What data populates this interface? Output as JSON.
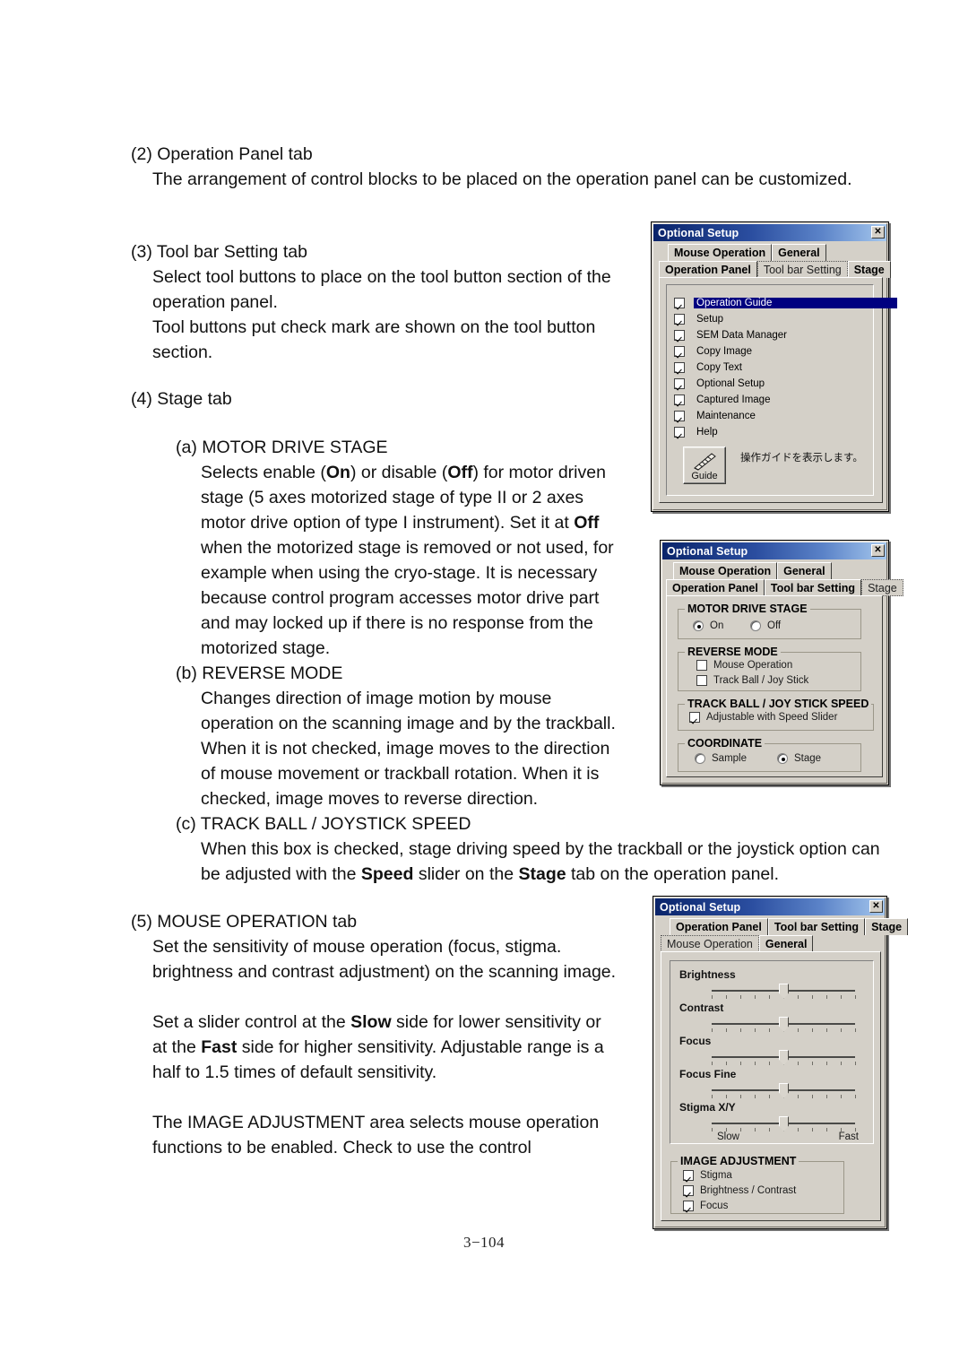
{
  "document": {
    "page_number": "3−104",
    "sections": [
      {
        "heading": "(2) Operation Panel tab",
        "body": "The arrangement of control blocks to be placed on the operation panel can be customized."
      },
      {
        "heading": "(3) Tool bar Setting tab",
        "body1": "Select tool buttons to place on the tool button section of the",
        "body2": "operation panel.",
        "body3": "Tool buttons put check mark are shown on the tool button",
        "body4": "section."
      },
      {
        "heading": "(4) Stage tab",
        "sub_a_title": "(a) MOTOR DRIVE STAGE",
        "sub_a_lines": [
          "Selects enable (On) or disable (Off) for motor driven",
          "stage (5 axes motorized stage of type II or 2 axes",
          "motor drive option of type I instrument). Set it at Off",
          "when the motorized stage is removed or not used, for",
          "example when using the cryo-stage. It is necessary",
          "because control program accesses motor drive part",
          "and may locked up if there is no response from the",
          "motorized stage."
        ],
        "sub_b_title": "(b) REVERSE MODE",
        "sub_b_lines": [
          "Changes direction of image motion by mouse",
          "operation on the scanning image and by the trackball.",
          "When it is not checked, image moves to the direction",
          "of mouse movement or trackball rotation. When it is",
          "checked, image moves to reverse direction."
        ],
        "sub_c_title": "(c) TRACK BALL / JOYSTICK SPEED",
        "sub_c_lines": [
          "When this box is checked, stage driving speed by the trackball or the joystick option can",
          "be adjusted with the Speed slider on the Stage tab on the operation panel."
        ]
      },
      {
        "heading": "(5) MOUSE OPERATION tab",
        "lines_a": [
          "Set the sensitivity of mouse operation (focus, stigma.",
          "brightness and contrast adjustment) on the scanning image."
        ],
        "lines_b": [
          "Set a slider control at the Slow side for lower sensitivity or",
          "at the Fast side for higher sensitivity. Adjustable range is a",
          "half to 1.5 times of default sensitivity."
        ],
        "lines_c": [
          "The IMAGE ADJUSTMENT area selects mouse operation",
          "functions to be enabled. Check to use the control"
        ]
      }
    ]
  },
  "colors": {
    "title_start": "#0a246a",
    "title_end": "#a6c8ee",
    "dialog_face": "#d4d0c8",
    "selection": "#000080",
    "selection_text": "#ffffff"
  },
  "dialog_toolbar": {
    "title": "Optional Setup",
    "close_label": "✕",
    "tabs_row1": [
      "Mouse Operation",
      "General"
    ],
    "tabs_row2": [
      "Operation Panel",
      "Tool bar Setting",
      "Stage"
    ],
    "selected_tab": "Tool bar Setting",
    "list_items": [
      {
        "label": "Operation Guide",
        "checked": true,
        "selected": true
      },
      {
        "label": "Setup",
        "checked": true,
        "selected": false
      },
      {
        "label": "SEM Data Manager",
        "checked": true,
        "selected": false
      },
      {
        "label": "Copy Image",
        "checked": true,
        "selected": false
      },
      {
        "label": "Copy Text",
        "checked": true,
        "selected": false
      },
      {
        "label": "Optional Setup",
        "checked": true,
        "selected": false
      },
      {
        "label": "Captured Image",
        "checked": true,
        "selected": false
      },
      {
        "label": "Maintenance",
        "checked": true,
        "selected": false
      },
      {
        "label": "Help",
        "checked": true,
        "selected": false
      }
    ],
    "guide_button_label": "Guide",
    "guide_hint": "操作ガイドを表示します。"
  },
  "dialog_stage": {
    "title": "Optional Setup",
    "close_label": "✕",
    "tabs_row1": [
      "Mouse Operation",
      "General"
    ],
    "tabs_row2": [
      "Operation Panel",
      "Tool bar Setting",
      "Stage"
    ],
    "selected_tab": "Stage",
    "motor_drive_stage": {
      "title": "MOTOR DRIVE STAGE",
      "options": [
        {
          "label": "On",
          "selected": true
        },
        {
          "label": "Off",
          "selected": false
        }
      ]
    },
    "reverse_mode": {
      "title": "REVERSE MODE",
      "options": [
        {
          "label": "Mouse Operation",
          "checked": false
        },
        {
          "label": "Track Ball / Joy Stick",
          "checked": false
        }
      ]
    },
    "track_ball_speed": {
      "title": "TRACK BALL / JOY STICK SPEED",
      "options": [
        {
          "label": "Adjustable with Speed Slider",
          "checked": true
        }
      ]
    },
    "coordinate": {
      "title": "COORDINATE",
      "options": [
        {
          "label": "Sample",
          "selected": false
        },
        {
          "label": "Stage",
          "selected": true
        }
      ]
    }
  },
  "dialog_mouse": {
    "title": "Optional Setup",
    "close_label": "✕",
    "tabs_row1": [
      "Operation Panel",
      "Tool bar Setting",
      "Stage"
    ],
    "tabs_row2": [
      "Mouse Operation",
      "General"
    ],
    "selected_tab": "Mouse Operation",
    "sliders": [
      {
        "label": "Brightness",
        "value": 50
      },
      {
        "label": "Contrast",
        "value": 50
      },
      {
        "label": "Focus",
        "value": 50
      },
      {
        "label": "Focus Fine",
        "value": 50
      },
      {
        "label": "Stigma X/Y",
        "value": 50
      }
    ],
    "scale_min_label": "Slow",
    "scale_max_label": "Fast",
    "image_adjustment": {
      "title": "IMAGE ADJUSTMENT",
      "options": [
        {
          "label": "Stigma",
          "checked": true
        },
        {
          "label": "Brightness / Contrast",
          "checked": true
        },
        {
          "label": "Focus",
          "checked": true
        }
      ]
    }
  }
}
